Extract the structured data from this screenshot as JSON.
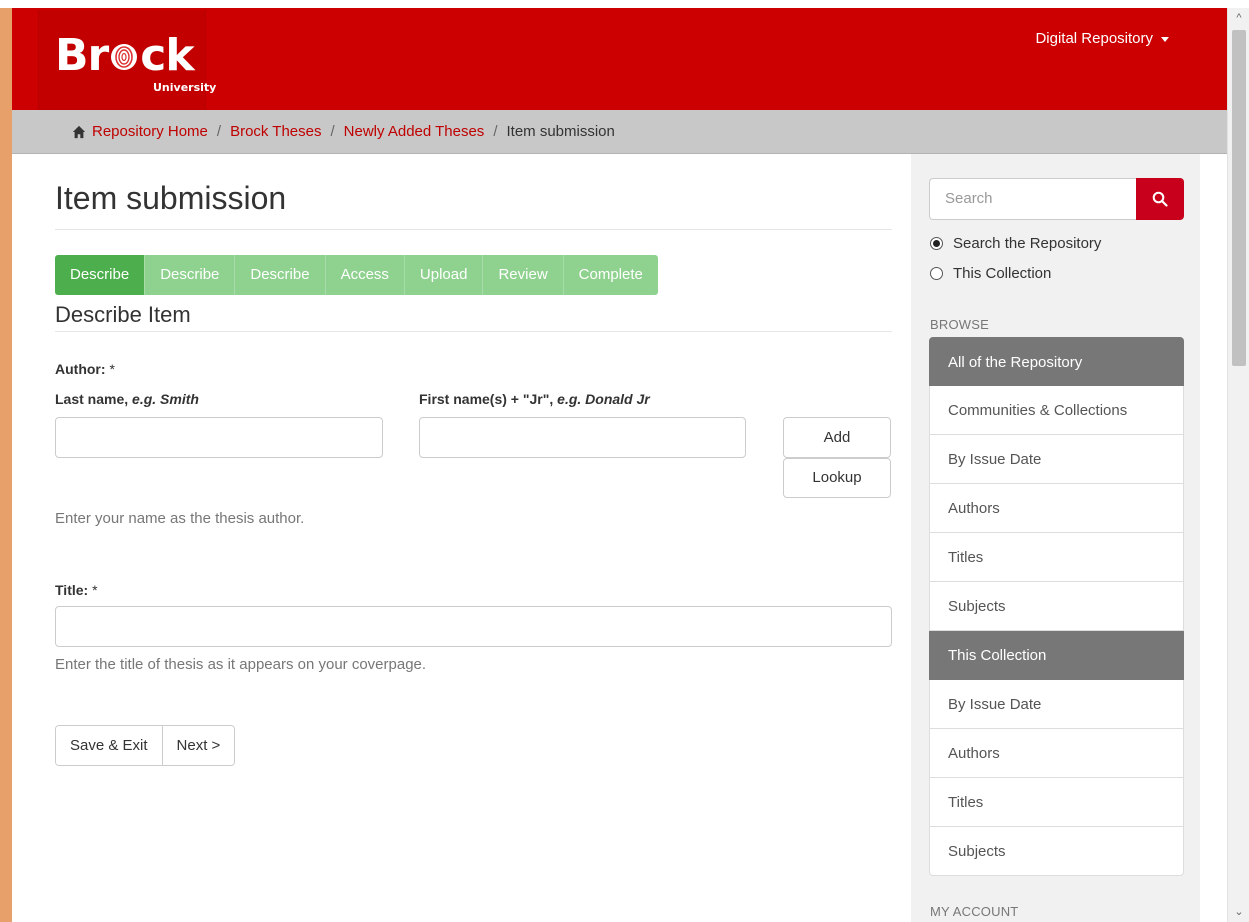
{
  "header": {
    "logo_text_a": "Br",
    "logo_text_b": "ck",
    "logo_sub": "University",
    "repo_menu": "Digital Repository"
  },
  "breadcrumb": {
    "items": [
      "Repository Home",
      "Brock Theses",
      "Newly Added Theses"
    ],
    "current": "Item submission"
  },
  "main": {
    "title": "Item submission",
    "steps": [
      {
        "label": "Describe",
        "active": true
      },
      {
        "label": "Describe",
        "active": false
      },
      {
        "label": "Describe",
        "active": false
      },
      {
        "label": "Access",
        "active": false
      },
      {
        "label": "Upload",
        "active": false
      },
      {
        "label": "Review",
        "active": false
      },
      {
        "label": "Complete",
        "active": false
      }
    ],
    "section_title": "Describe Item",
    "author": {
      "label": "Author:",
      "required": "*",
      "last_name_label": "Last name,",
      "last_name_example": "e.g. Smith",
      "first_name_label": "First name(s) + \"Jr\",",
      "first_name_example": "e.g. Donald Jr",
      "last_name_value": "",
      "first_name_value": "",
      "add_label": "Add",
      "lookup_label": "Lookup",
      "help": "Enter your name as the thesis author."
    },
    "title_field": {
      "label": "Title:",
      "required": "*",
      "value": "",
      "help": "Enter the title of thesis as it appears on your coverpage."
    },
    "save_exit_label": "Save & Exit",
    "next_label": "Next >"
  },
  "sidebar": {
    "search_placeholder": "Search",
    "scope_repository": "Search the Repository",
    "scope_collection": "This Collection",
    "browse_heading": "BROWSE",
    "repo_heading": "All of the Repository",
    "repo_items": [
      "Communities & Collections",
      "By Issue Date",
      "Authors",
      "Titles",
      "Subjects"
    ],
    "collection_heading": "This Collection",
    "collection_items": [
      "By Issue Date",
      "Authors",
      "Titles",
      "Subjects"
    ],
    "account_heading": "MY ACCOUNT"
  },
  "colors": {
    "brand_red": "#cc0000",
    "active_step": "#4cae4c",
    "inactive_step": "#8fd18f",
    "search_button": "#c9001c"
  },
  "icons": [
    "home-icon",
    "search-icon",
    "caret-down-icon",
    "scroll-up-icon",
    "scroll-down-icon"
  ]
}
